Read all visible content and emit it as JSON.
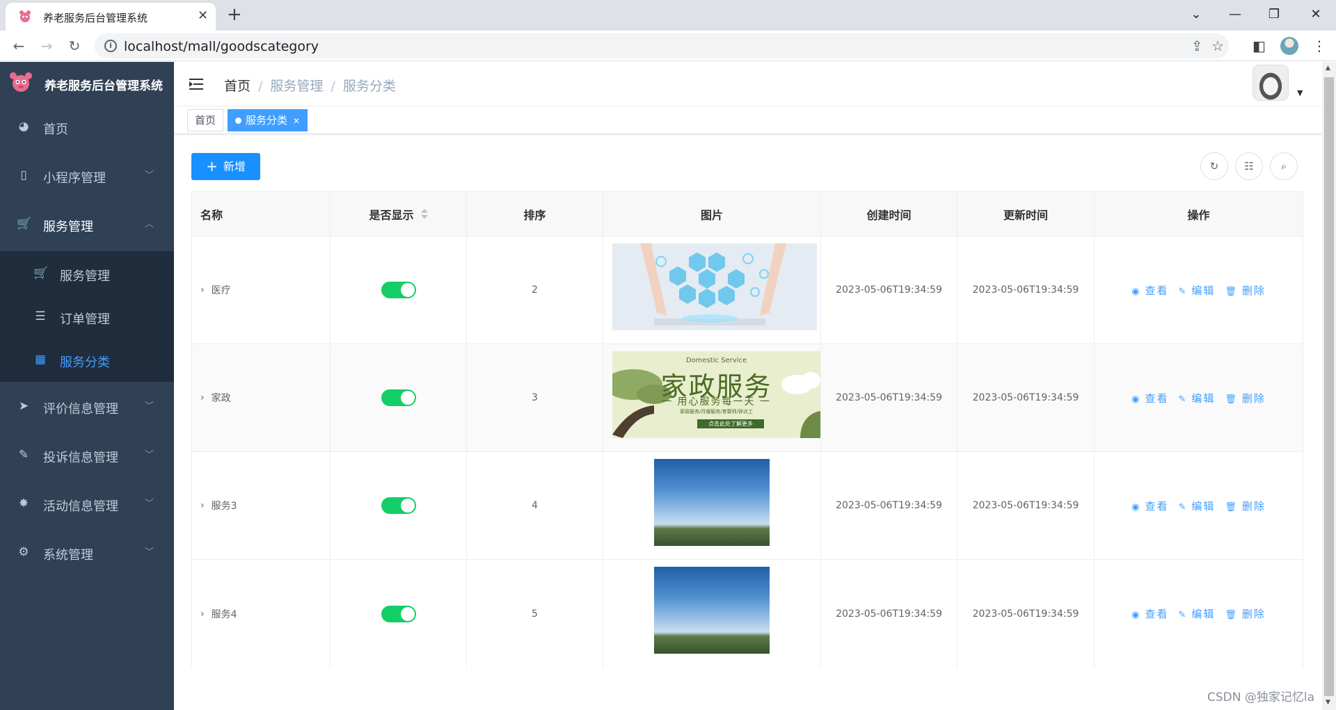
{
  "browser": {
    "tab_title": "养老服务后台管理系统",
    "url": "localhost/mall/goodscategory"
  },
  "sidebar": {
    "title": "养老服务后台管理系统",
    "items": [
      {
        "label": "首页",
        "icon": "dashboard-icon"
      },
      {
        "label": "小程序管理",
        "icon": "phone-icon"
      },
      {
        "label": "服务管理",
        "icon": "cart-icon",
        "open": true
      },
      {
        "label": "评价信息管理",
        "icon": "send-icon"
      },
      {
        "label": "投诉信息管理",
        "icon": "edit-doc-icon"
      },
      {
        "label": "活动信息管理",
        "icon": "bug-icon"
      },
      {
        "label": "系统管理",
        "icon": "gear-icon"
      }
    ],
    "subitems": [
      {
        "label": "服务管理",
        "icon": "cart-icon"
      },
      {
        "label": "订单管理",
        "icon": "list-icon"
      },
      {
        "label": "服务分类",
        "icon": "table-icon",
        "active": true
      }
    ]
  },
  "header": {
    "breadcrumb": [
      "首页",
      "服务管理",
      "服务分类"
    ],
    "separator": "/"
  },
  "tags": [
    {
      "label": "首页",
      "active": false
    },
    {
      "label": "服务分类",
      "active": true
    }
  ],
  "toolbar": {
    "add_label": "新增"
  },
  "table": {
    "columns": [
      "名称",
      "是否显示",
      "排序",
      "图片",
      "创建时间",
      "更新时间",
      "操作"
    ],
    "rows": [
      {
        "name": "医疗",
        "show": true,
        "sort": "2",
        "image": "medical",
        "created": "2023-05-06T19:34:59",
        "updated": "2023-05-06T19:34:59"
      },
      {
        "name": "家政",
        "show": true,
        "sort": "3",
        "image": "domestic",
        "created": "2023-05-06T19:34:59",
        "updated": "2023-05-06T19:34:59"
      },
      {
        "name": "服务3",
        "show": true,
        "sort": "4",
        "image": "sky",
        "created": "2023-05-06T19:34:59",
        "updated": "2023-05-06T19:34:59"
      },
      {
        "name": "服务4",
        "show": true,
        "sort": "5",
        "image": "sky",
        "created": "2023-05-06T19:34:59",
        "updated": "2023-05-06T19:34:59"
      }
    ],
    "actions": {
      "view": "查看",
      "edit": "编辑",
      "delete": "删除"
    }
  },
  "images": {
    "domestic": {
      "subtitle_en": "Domestic Service",
      "title": "家政服务",
      "slogan": "一 用心服务每一天 一",
      "services": "家政服务/月嫂服务/育婴师/钟点工",
      "cta": "点击此处了解更多"
    }
  },
  "colors": {
    "sidebar_bg": "#304156",
    "submenu_bg": "#1f2d3d",
    "primary": "#409eff",
    "add_button": "#1890ff",
    "switch_on": "#13ce66"
  },
  "watermark": "CSDN @独家记忆la"
}
